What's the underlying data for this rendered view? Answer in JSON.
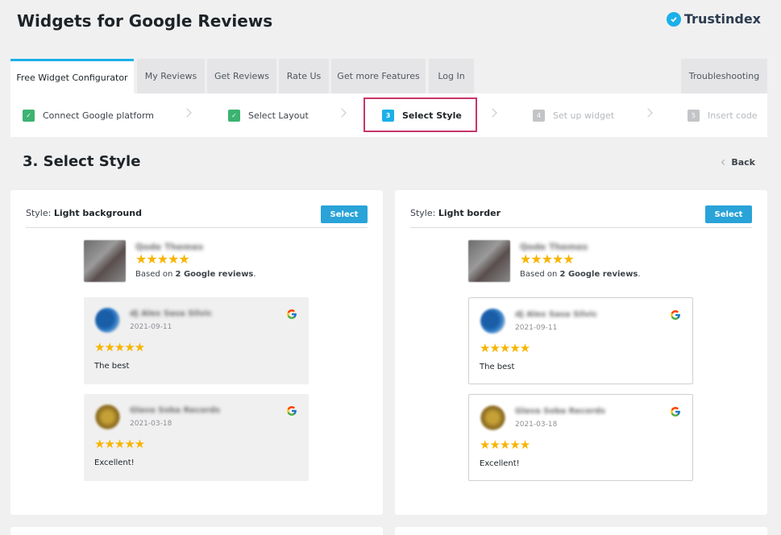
{
  "header": {
    "title": "Widgets for Google Reviews",
    "brand": "Trustindex"
  },
  "tabs": [
    {
      "label": "Free Widget Configurator"
    },
    {
      "label": "My Reviews"
    },
    {
      "label": "Get Reviews"
    },
    {
      "label": "Rate Us"
    },
    {
      "label": "Get more Features"
    },
    {
      "label": "Log In"
    },
    {
      "label": "Troubleshooting"
    }
  ],
  "steps": [
    {
      "num": "✓",
      "label": "Connect Google platform",
      "state": "done"
    },
    {
      "num": "✓",
      "label": "Select Layout",
      "state": "done"
    },
    {
      "num": "3",
      "label": "Select Style",
      "state": "current"
    },
    {
      "num": "4",
      "label": "Set up widget",
      "state": "pending"
    },
    {
      "num": "5",
      "label": "Insert code",
      "state": "pending"
    }
  ],
  "section": {
    "title": "3. Select Style",
    "back": "Back"
  },
  "cards": [
    {
      "style_prefix": "Style:",
      "style_name": "Light background",
      "select_label": "Select",
      "business_name": "Qode Themes",
      "stars": "★★★★★",
      "based_prefix": "Based on ",
      "based_bold": "2 Google reviews",
      "based_suffix": ".",
      "reviews": [
        {
          "name": "dj Alex Sasa Silvic",
          "date": "2021-09-11",
          "stars": "★★★★★",
          "text": "The best"
        },
        {
          "name": "Glava Soba Records",
          "date": "2021-03-18",
          "stars": "★★★★★",
          "text": "Excellent!"
        }
      ]
    },
    {
      "style_prefix": "Style:",
      "style_name": "Light border",
      "select_label": "Select",
      "business_name": "Qode Themes",
      "stars": "★★★★★",
      "based_prefix": "Based on ",
      "based_bold": "2 Google reviews",
      "based_suffix": ".",
      "reviews": [
        {
          "name": "dj Alex Sasa Silvic",
          "date": "2021-09-11",
          "stars": "★★★★★",
          "text": "The best"
        },
        {
          "name": "Glava Soba Records",
          "date": "2021-03-18",
          "stars": "★★★★★",
          "text": "Excellent!"
        }
      ]
    }
  ],
  "colors": {
    "accent": "#1ab0e9",
    "done": "#3cb371",
    "highlight": "#c7356b",
    "star": "#f7b500"
  },
  "icons": {
    "brand": "check-circle-icon",
    "review_source": "google-icon",
    "back": "chevron-left-icon",
    "step_separator": "chevron-right-icon"
  }
}
